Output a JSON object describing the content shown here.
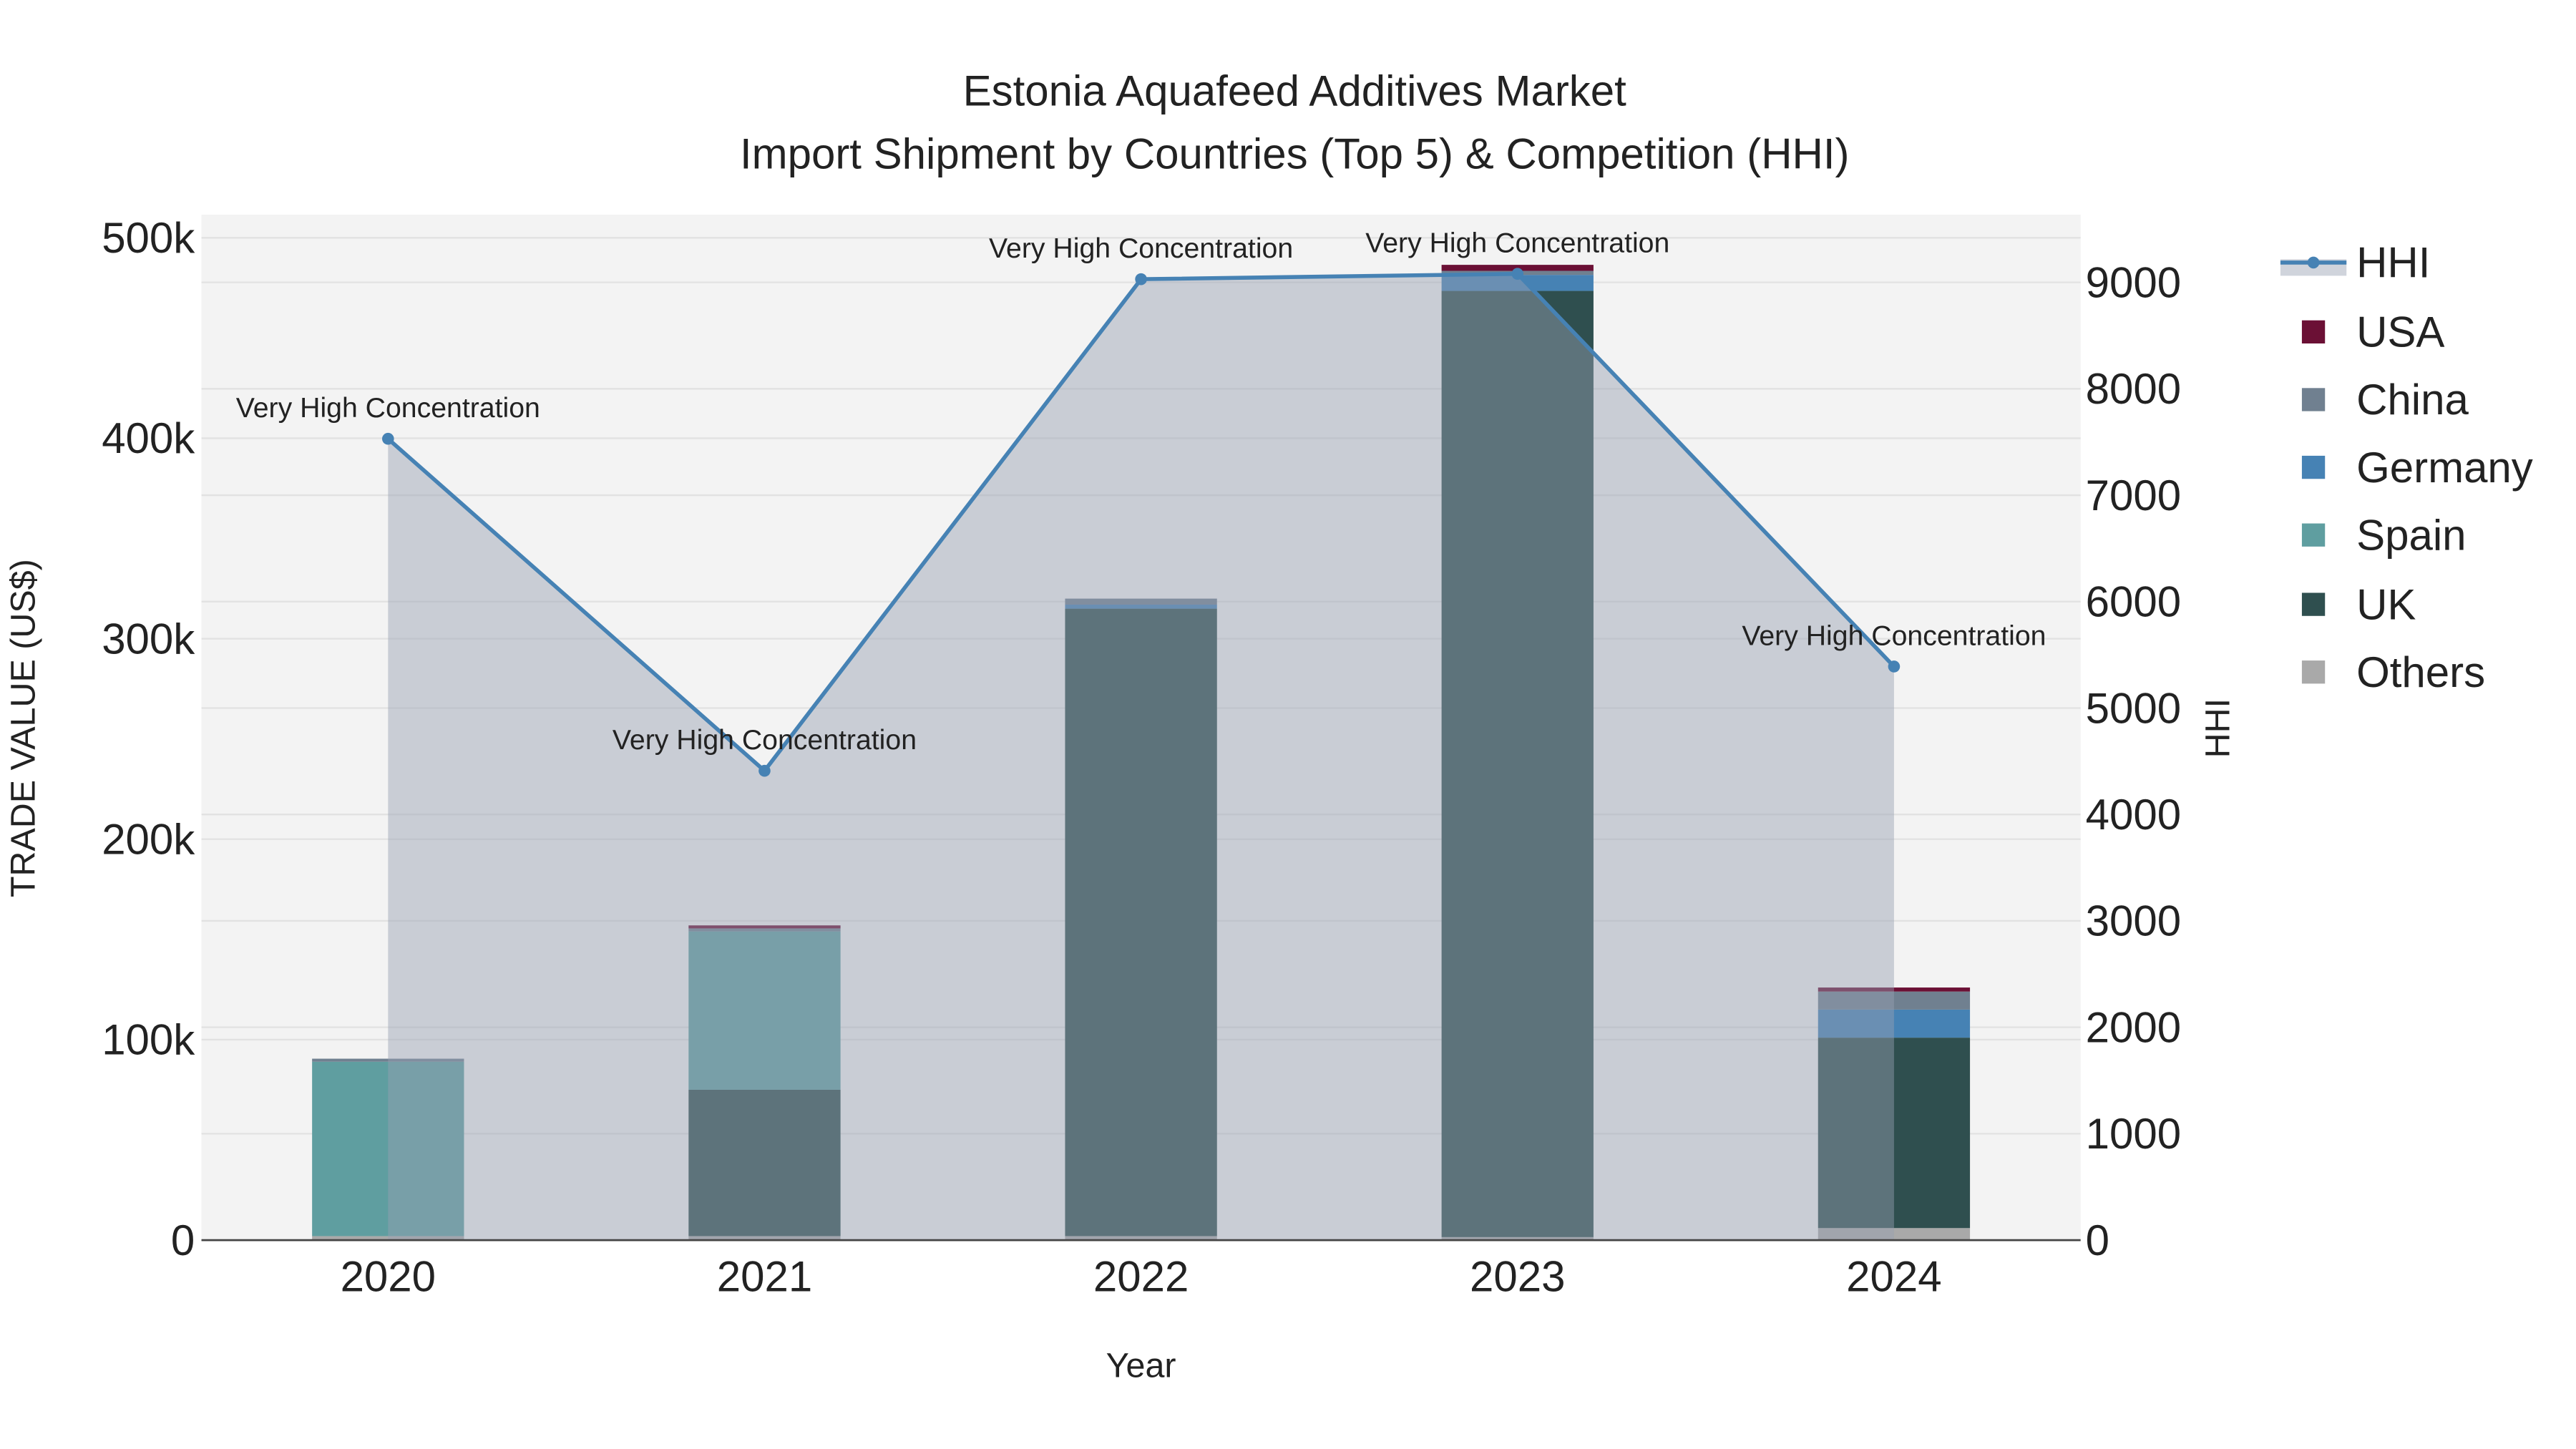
{
  "chart_data": {
    "type": "bar",
    "title": "Estonia Aquafeed Additives Market",
    "subtitle": "Import Shipment by Countries (Top 5) & Competition (HHI)",
    "xlabel": "Year",
    "ylabel": "TRADE VALUE (US$)",
    "y2label": "HHI",
    "categories": [
      "2020",
      "2021",
      "2022",
      "2023",
      "2024"
    ],
    "ylim": [
      0,
      510000
    ],
    "y2lim": [
      0,
      9650
    ],
    "yticks": [
      0,
      100000,
      200000,
      300000,
      400000,
      500000
    ],
    "ytick_labels": [
      "0",
      "100k",
      "200k",
      "300k",
      "400k",
      "500k"
    ],
    "y2ticks": [
      0,
      1000,
      2000,
      3000,
      4000,
      5000,
      6000,
      7000,
      8000,
      9000
    ],
    "y2tick_labels": [
      "0",
      "1000",
      "2000",
      "3000",
      "4000",
      "5000",
      "6000",
      "7000",
      "8000",
      "9000"
    ],
    "grid": true,
    "barmode": "stack",
    "legend_position": "right",
    "series": [
      {
        "name": "Others",
        "color": "#a9a9a9",
        "values": [
          2000,
          2000,
          2000,
          1500,
          6000
        ]
      },
      {
        "name": "UK",
        "color": "#2f4f4f",
        "values": [
          0,
          73000,
          313000,
          472000,
          95000
        ]
      },
      {
        "name": "Spain",
        "color": "#5f9ea0",
        "values": [
          87000,
          79000,
          0,
          0,
          0
        ]
      },
      {
        "name": "Germany",
        "color": "#4682b4",
        "values": [
          0,
          0,
          2000,
          8000,
          14000
        ]
      },
      {
        "name": "China",
        "color": "#708090",
        "values": [
          1500,
          1500,
          3000,
          2000,
          9000
        ]
      },
      {
        "name": "USA",
        "color": "#6b1035",
        "values": [
          0,
          1500,
          0,
          3000,
          2000
        ]
      }
    ],
    "legend_order": [
      "HHI",
      "USA",
      "China",
      "Germany",
      "Spain",
      "UK",
      "Others"
    ],
    "hhi": {
      "name": "HHI",
      "color": "#4682b4",
      "values": [
        7530,
        4410,
        9030,
        9080,
        5390
      ],
      "annotations": [
        "Very High Concentration",
        "Very High Concentration",
        "Very High Concentration",
        "Very High Concentration",
        "Very High Concentration"
      ]
    }
  }
}
